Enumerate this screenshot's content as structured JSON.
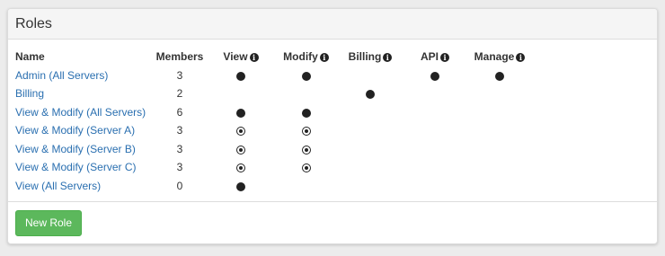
{
  "panel": {
    "title": "Roles"
  },
  "table": {
    "headers": {
      "name": "Name",
      "members": "Members",
      "view": "View",
      "modify": "Modify",
      "billing": "Billing",
      "api": "API",
      "manage": "Manage"
    },
    "info_icon": "info-circle-icon",
    "legend": {
      "full": "filled-circle-icon",
      "partial": "dotted-circle-icon",
      "none": "empty-circle-icon"
    },
    "rows": [
      {
        "name": "Admin (All Servers)",
        "members": "3",
        "view": "full",
        "modify": "full",
        "billing": "none",
        "api": "full",
        "manage": "full"
      },
      {
        "name": "Billing",
        "members": "2",
        "view": "none",
        "modify": "none",
        "billing": "full",
        "api": "none",
        "manage": "none"
      },
      {
        "name": "View & Modify (All Servers)",
        "members": "6",
        "view": "full",
        "modify": "full",
        "billing": "none",
        "api": "none",
        "manage": "none"
      },
      {
        "name": "View & Modify (Server A)",
        "members": "3",
        "view": "partial",
        "modify": "partial",
        "billing": "none",
        "api": "none",
        "manage": "none"
      },
      {
        "name": "View & Modify (Server B)",
        "members": "3",
        "view": "partial",
        "modify": "partial",
        "billing": "none",
        "api": "none",
        "manage": "none"
      },
      {
        "name": "View & Modify (Server C)",
        "members": "3",
        "view": "partial",
        "modify": "partial",
        "billing": "none",
        "api": "none",
        "manage": "none"
      },
      {
        "name": "View (All Servers)",
        "members": "0",
        "view": "full",
        "modify": "none",
        "billing": "none",
        "api": "none",
        "manage": "none"
      }
    ]
  },
  "actions": {
    "new_role_label": "New Role"
  },
  "colors": {
    "link": "#2a6fb0",
    "button_green": "#5cb85c",
    "heading_bg": "#f5f5f5",
    "page_bg": "#ececec"
  }
}
